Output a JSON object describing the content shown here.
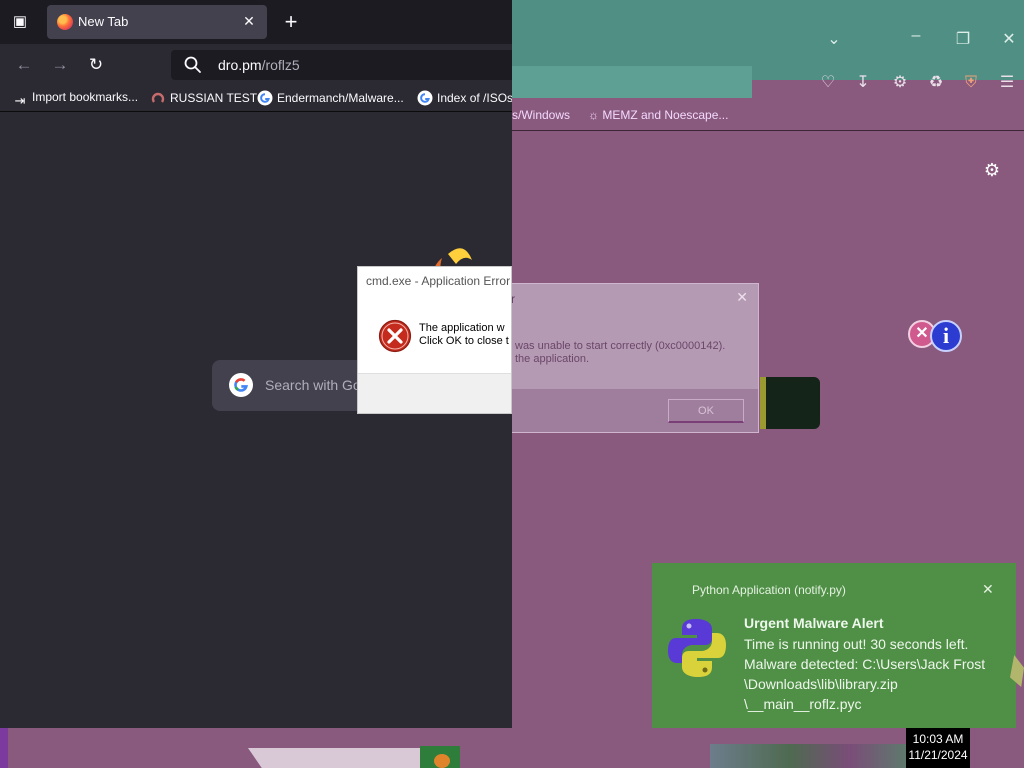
{
  "browser": {
    "tab": {
      "title": "New Tab"
    },
    "address": {
      "host": "dro.pm",
      "path": "/roflz5"
    },
    "bookmarks": [
      {
        "label": "Import bookmarks...",
        "icon": "import-icon"
      },
      {
        "label": "RUSSIAN TEST",
        "icon": "bookmark-favicon"
      },
      {
        "label": "Endermanch/Malware...",
        "icon": "google-icon"
      },
      {
        "label": "Index of /ISOs",
        "icon": "google-icon"
      }
    ],
    "ntp_search_placeholder": "Search with Go"
  },
  "glitched_browser": {
    "bookmark_fragment": "s/Windows",
    "bookmark_item": "MEMZ and Noescape..."
  },
  "error_dialog": {
    "title": "cmd.exe - Application Error",
    "message_line1": "The application w",
    "message_line2": "Click OK to close t"
  },
  "ghost_dialog": {
    "title_fragment": "r",
    "message_line1": "was unable to start correctly (0xc0000142).",
    "message_line2": "the application.",
    "ok_label": "OK"
  },
  "toast": {
    "app_name": "Python Application (notify.py)",
    "heading": "Urgent Malware Alert",
    "lines": [
      "Time is running out! 30 seconds left.",
      "Malware detected: C:\\Users\\Jack Frost",
      "\\Downloads\\lib\\library.zip",
      "\\__main__roflz.pyc"
    ]
  },
  "clock": {
    "time": "10:03 AM",
    "date": "11/21/2024"
  },
  "colors": {
    "browser_bg": "#2b2a33",
    "tabbar_bg": "#1c1b22",
    "glitch_bg": "#8a5a7e",
    "toast_bg": "#4f8f46",
    "error_red": "#c42b1c"
  }
}
